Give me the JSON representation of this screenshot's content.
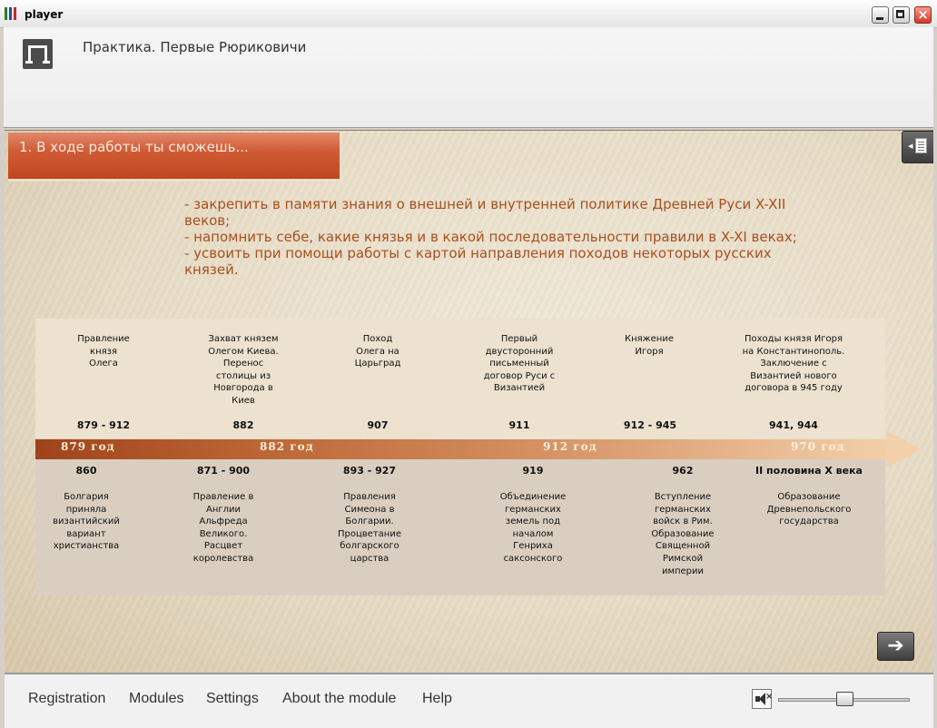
{
  "window": {
    "title": "player"
  },
  "header": {
    "title": "Практика. Первые Рюриковичи"
  },
  "section": {
    "title": "1. В ходе работы ты сможешь..."
  },
  "goals": [
    "- закрепить в памяти знания о внешней и внутренней политике Древней Руси X-XII",
    "веков;",
    "- напомнить себе, какие князья и в какой последовательности правили в X-XI веках;",
    "- усвоить при помощи работы с картой направления походов некоторых русских",
    "князей."
  ],
  "timeline": {
    "markers": [
      "879 год",
      "882 год",
      "912 год",
      "970 год"
    ],
    "rus_events": [
      {
        "text": [
          "Правление",
          "князя",
          "Олега"
        ],
        "year": "879 - 912"
      },
      {
        "text": [
          "Захват князем",
          "Олегом Киева.",
          "Перенос",
          "столицы из",
          "Новгорода в",
          "Киев"
        ],
        "year": "882"
      },
      {
        "text": [
          "Поход",
          "Олега на",
          "Царьград"
        ],
        "year": "907"
      },
      {
        "text": [
          "Первый",
          "двусторонний",
          "письменный",
          "договор Руси с",
          "Византией"
        ],
        "year": "911"
      },
      {
        "text": [
          "Княжение",
          "Игоря"
        ],
        "year": "912 - 945"
      },
      {
        "text": [
          "Походы князя Игоря",
          "на Константинополь.",
          "Заключение с",
          "Византией нового",
          "договора в 945 году"
        ],
        "year": "941, 944"
      }
    ],
    "world_events": [
      {
        "year": "860",
        "text": [
          "Болгария",
          "приняла",
          "византийский",
          "вариант",
          "христианства"
        ]
      },
      {
        "year": "871 - 900",
        "text": [
          "Правление в",
          "Англии",
          "Альфреда",
          "Великого.",
          "Расцвет",
          "королевства"
        ]
      },
      {
        "year": "893 - 927",
        "text": [
          "Правления",
          "Симеона в",
          "Болгарии.",
          "Процветание",
          "болгарского",
          "царства"
        ]
      },
      {
        "year": "919",
        "text": [
          "Объединение",
          "германских",
          "земель под",
          "началом",
          "Генриха",
          "саксонского"
        ]
      },
      {
        "year": "962",
        "text": [
          "Вступление",
          "германских",
          "войск в Рим.",
          "Образование",
          "Священной",
          "Римской",
          "империи"
        ]
      },
      {
        "year": "II половина X века",
        "text": [
          "Образование",
          "Древнепольского",
          "государства"
        ]
      }
    ]
  },
  "footer": {
    "nav": [
      "Registration",
      "Modules",
      "Settings",
      "About the module",
      "Help"
    ]
  },
  "volume": {
    "level": 0.5
  },
  "icons": {
    "app": "player-app-icon",
    "logo": "module-logo-icon",
    "toc": "table-of-contents-icon",
    "next": "next-arrow-icon",
    "volume": "speaker-mute-icon"
  },
  "colors": {
    "section_accent": "#c2461f",
    "goals_text": "#a8501d",
    "timeline_start": "#a0431c",
    "timeline_end": "#f2cfa8"
  }
}
